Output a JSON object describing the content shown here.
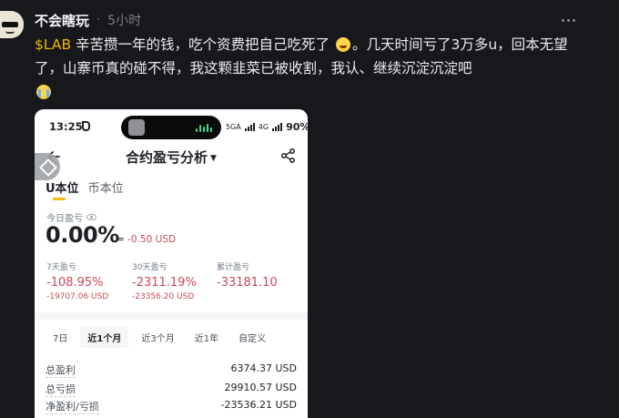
{
  "post": {
    "username": "不会瞎玩",
    "time": "5小时",
    "ticker": "$LAB",
    "text_1": " 辛苦攒一年的钱，吃个资费把自己吃死了",
    "text_2": "。几天时间亏了3万多u，回本无望了，山寨币真的碰不得，我这颗韭菜已被收割，我认、继续沉淀沉淀吧",
    "emoji_1": "grinning-sweat-emoji",
    "emoji_2": "crying-emoji"
  },
  "phone": {
    "status_time": "13:25",
    "network_1": "5GA",
    "network_2": "4G",
    "battery": "90%",
    "nav_title": "合约盈亏分析",
    "tabs": [
      {
        "label": "U本位",
        "active": true
      },
      {
        "label": "币本位",
        "active": false
      }
    ],
    "today": {
      "label": "今日盈亏",
      "pct": "0.00%",
      "usd": "-0.50 USD"
    },
    "stats": [
      {
        "label": "7天盈亏",
        "pct": "-108.95%",
        "usd": "-19707.06 USD"
      },
      {
        "label": "30天盈亏",
        "pct": "-2311.19%",
        "usd": "-23356.20 USD"
      },
      {
        "label": "累计盈亏",
        "pct": "-33181.10",
        "usd": ""
      }
    ],
    "periods": [
      {
        "label": "7日",
        "active": false
      },
      {
        "label": "近1个月",
        "active": true
      },
      {
        "label": "近3个月",
        "active": false
      },
      {
        "label": "近1年",
        "active": false
      },
      {
        "label": "自定义",
        "active": false
      }
    ],
    "summary": [
      {
        "label": "总盈利",
        "value": "6374.37 USD"
      },
      {
        "label": "总亏损",
        "value": "29910.57 USD"
      },
      {
        "label": "净盈利/亏损",
        "value": "-23536.21 USD"
      }
    ],
    "colors": {
      "loss": "#c84a5a",
      "accent": "#f0b90b"
    }
  }
}
